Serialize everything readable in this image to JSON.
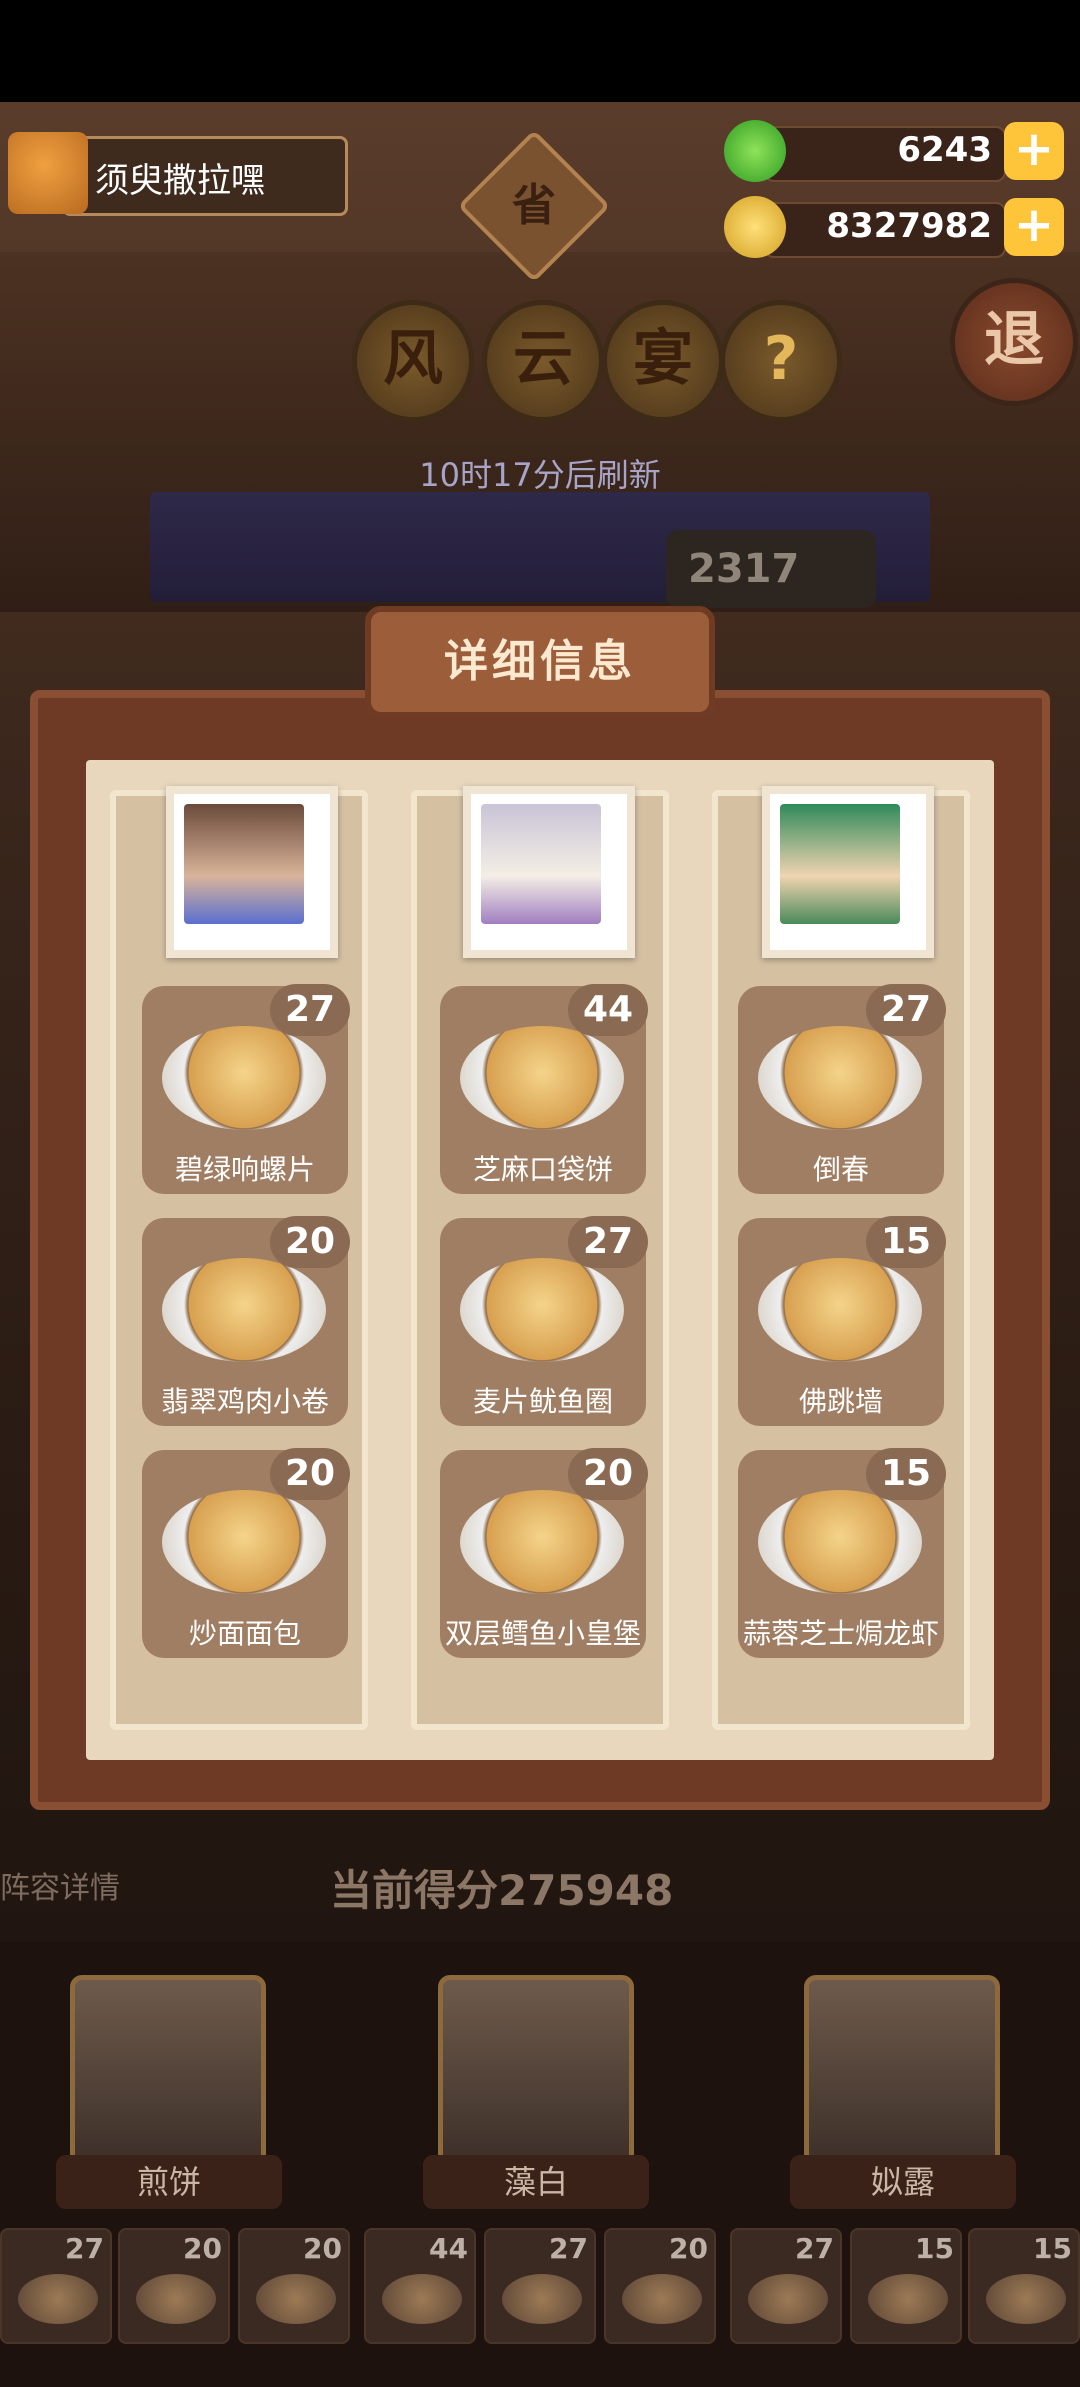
{
  "player": {
    "name": "须臾撒拉嘿"
  },
  "resources": {
    "jade": {
      "value": "6243",
      "plus": "+"
    },
    "coins": {
      "value": "8327982",
      "plus": "+"
    }
  },
  "province_badge": "省",
  "event_title": [
    "风",
    "云",
    "宴"
  ],
  "help": "?",
  "exit": "退",
  "refresh_text": "10时17分后刷新",
  "score_chip": "2317",
  "modal": {
    "title": "详细信息",
    "columns": [
      {
        "dishes": [
          {
            "name": "碧绿响螺片",
            "count": "27"
          },
          {
            "name": "翡翠鸡肉小卷",
            "count": "20"
          },
          {
            "name": "炒面面包",
            "count": "20"
          }
        ]
      },
      {
        "dishes": [
          {
            "name": "芝麻口袋饼",
            "count": "44"
          },
          {
            "name": "麦片鱿鱼圈",
            "count": "27"
          },
          {
            "name": "双层鳕鱼小皇堡",
            "count": "20"
          }
        ]
      },
      {
        "dishes": [
          {
            "name": "倒春",
            "count": "27"
          },
          {
            "name": "佛跳墙",
            "count": "15"
          },
          {
            "name": "蒜蓉芝士焗龙虾",
            "count": "15"
          }
        ]
      }
    ]
  },
  "bottom": {
    "lineup_label": "阵容详情",
    "score_text": "当前得分275948",
    "characters": [
      "煎饼",
      "藻白",
      "姒露"
    ],
    "strip_counts": [
      "27",
      "20",
      "20",
      "44",
      "27",
      "20",
      "27",
      "15",
      "15"
    ]
  },
  "colors": {
    "accent_gold": "#ffc53a",
    "panel_brown": "#6e3a26",
    "cream": "#e8d7bd"
  }
}
